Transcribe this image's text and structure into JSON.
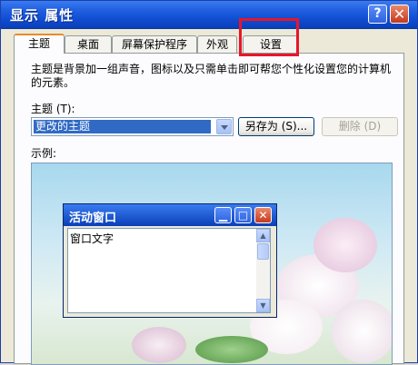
{
  "window": {
    "title": "显示 属性",
    "help_symbol": "?",
    "close_symbol": "✕"
  },
  "tabs": [
    {
      "label": "主题"
    },
    {
      "label": "桌面"
    },
    {
      "label": "屏幕保护程序"
    },
    {
      "label": "外观"
    },
    {
      "label": "设置"
    }
  ],
  "theme_page": {
    "description": "主题是背景加一组声音，图标以及只需单击即可帮您个性化设置您的计算机的元素。",
    "theme_label": "主题 (T):",
    "theme_value": "更改的主题",
    "save_as_label": "另存为 (S)...",
    "delete_label": "删除 (D)",
    "sample_label": "示例:"
  },
  "preview_window": {
    "title": "活动窗口",
    "content_text": "窗口文字",
    "min_symbol": "▁",
    "max_symbol": "□",
    "close_symbol": "✕"
  },
  "colors": {
    "titlebar": "#0f4bd0",
    "highlight": "#e8152a",
    "selection": "#316ac5"
  },
  "icons": [
    "help-icon",
    "close-icon",
    "chevron-down-icon",
    "minimize-icon",
    "maximize-icon",
    "scroll-up-icon",
    "scroll-down-icon"
  ]
}
